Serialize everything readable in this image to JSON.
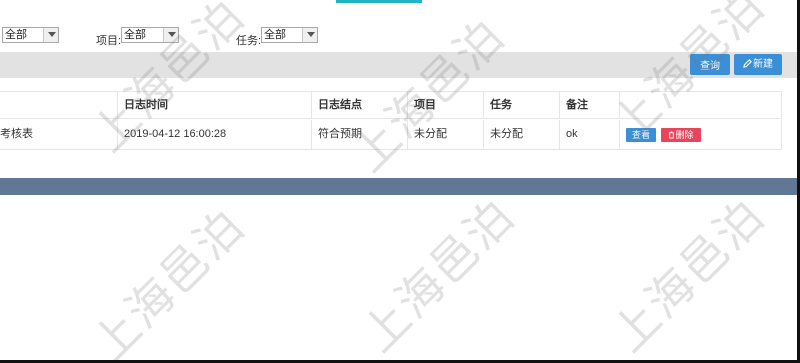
{
  "filters": {
    "first_value": "全部",
    "project_label": "项目:",
    "project_value": "全部",
    "task_label": "任务:",
    "task_value": "全部"
  },
  "toolbar": {
    "query_label": "查询",
    "create_label": "新建"
  },
  "table": {
    "headers": [
      "日志时间",
      "日志结点",
      "项目",
      "任务",
      "备注"
    ],
    "rows": [
      {
        "name": "考核表",
        "time": "2019-04-12 16:00:28",
        "node": "符合预期",
        "project": "未分配",
        "task": "未分配",
        "remark": "ok",
        "view_label": "查看",
        "delete_label": "删除"
      }
    ]
  },
  "watermark": "上海邑泊",
  "colors": {
    "primary": "#3a8fd6",
    "danger": "#e8445a",
    "footer": "#607895",
    "accent_tab": "#1fb5c4"
  }
}
